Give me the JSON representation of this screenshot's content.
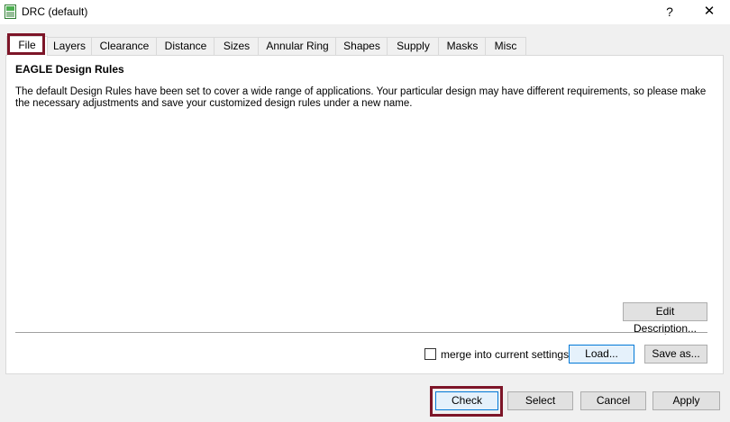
{
  "window": {
    "title": "DRC (default)",
    "help_label": "?",
    "close_label": "✕"
  },
  "tabs": [
    {
      "label": "File",
      "active": true
    },
    {
      "label": "Layers"
    },
    {
      "label": "Clearance"
    },
    {
      "label": "Distance"
    },
    {
      "label": "Sizes"
    },
    {
      "label": "Annular Ring"
    },
    {
      "label": "Shapes"
    },
    {
      "label": "Supply"
    },
    {
      "label": "Masks"
    },
    {
      "label": "Misc"
    }
  ],
  "file_panel": {
    "heading": "EAGLE Design Rules",
    "description": "The default Design Rules have been set to cover a wide range of applications. Your particular design may have different requirements, so please make the necessary adjustments and save your customized design rules under a new name.",
    "edit_description_label": "Edit Description...",
    "merge_label": "merge into current settings",
    "merge_checked": false,
    "load_label": "Load...",
    "save_as_label": "Save as..."
  },
  "footer": {
    "check_label": "Check",
    "select_label": "Select",
    "cancel_label": "Cancel",
    "apply_label": "Apply"
  },
  "colors": {
    "highlight": "#7d1528",
    "focus_border": "#0078d7"
  }
}
